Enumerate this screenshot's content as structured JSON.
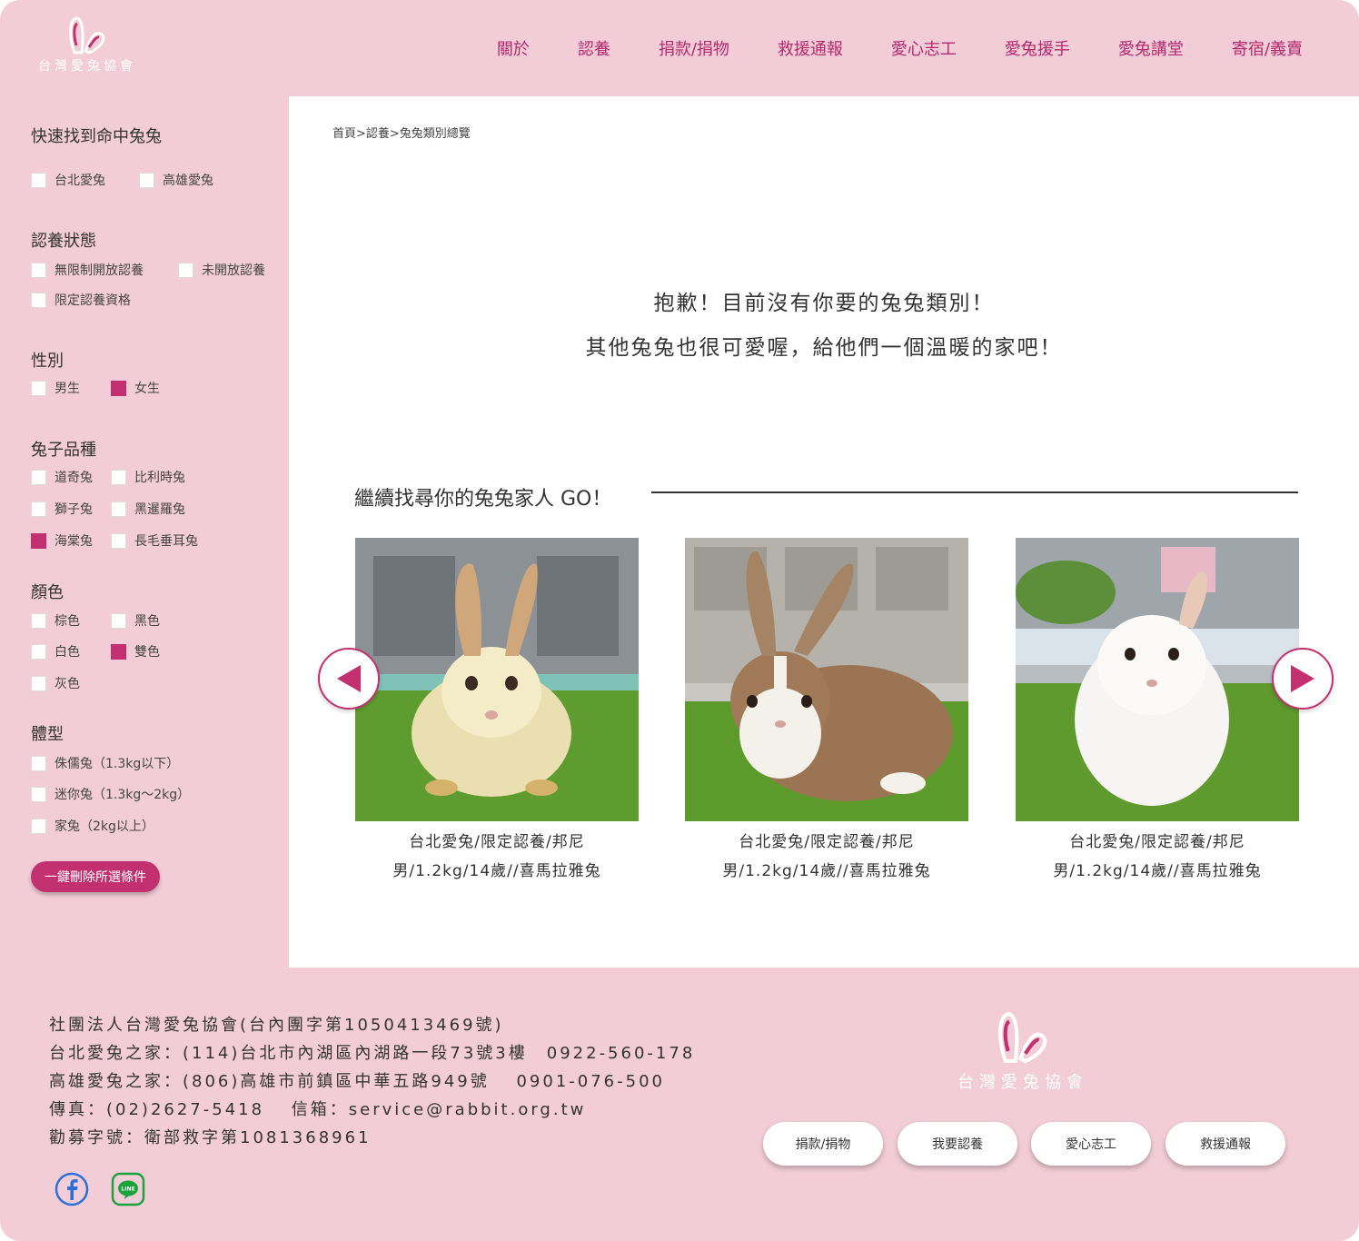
{
  "brand": {
    "logo_text": "台灣愛兔協會",
    "accent": "#c2306f",
    "bg": "#f2cdd8"
  },
  "nav": [
    "關於",
    "認養",
    "捐款/捐物",
    "救援通報",
    "愛心志工",
    "愛兔援手",
    "愛兔講堂",
    "寄宿/義賣"
  ],
  "filters": {
    "location": {
      "title": "快速找到命中兔兔",
      "options": [
        {
          "label": "台北愛兔",
          "checked": false
        },
        {
          "label": "高雄愛兔",
          "checked": false
        }
      ]
    },
    "status": {
      "title": "認養狀態",
      "options": [
        {
          "label": "無限制開放認養",
          "checked": false
        },
        {
          "label": "未開放認養",
          "checked": false
        },
        {
          "label": "限定認養資格",
          "checked": false
        }
      ]
    },
    "gender": {
      "title": "性別",
      "options": [
        {
          "label": "男生",
          "checked": false
        },
        {
          "label": "女生",
          "checked": true
        }
      ]
    },
    "breed": {
      "title": "兔子品種",
      "options": [
        {
          "label": "道奇兔",
          "checked": false
        },
        {
          "label": "比利時兔",
          "checked": false
        },
        {
          "label": "獅子兔",
          "checked": false
        },
        {
          "label": "黑暹羅兔",
          "checked": false
        },
        {
          "label": "海棠兔",
          "checked": true
        },
        {
          "label": "長毛垂耳兔",
          "checked": false
        }
      ]
    },
    "color": {
      "title": "顏色",
      "options": [
        {
          "label": "棕色",
          "checked": false
        },
        {
          "label": "黑色",
          "checked": false
        },
        {
          "label": "白色",
          "checked": false
        },
        {
          "label": "雙色",
          "checked": true
        },
        {
          "label": "灰色",
          "checked": false
        }
      ]
    },
    "size": {
      "title": "體型",
      "options": [
        {
          "label": "侏儒兔（1.3kg以下）",
          "checked": false
        },
        {
          "label": "迷你兔（1.3kg～2kg）",
          "checked": false
        },
        {
          "label": "家兔（2kg以上）",
          "checked": false
        }
      ]
    },
    "clear_label": "一鍵刪除所選條件"
  },
  "main": {
    "breadcrumb": "首頁>認養>兔兔類別總覽",
    "message_line1": "抱歉！目前沒有你要的兔兔類別！",
    "message_line2": "其他兔兔也很可愛喔，給他們一個溫暖的家吧！",
    "continue_title": "繼續找尋你的兔兔家人 GO！",
    "cards": [
      {
        "line1": "台北愛兔/限定認養/邦尼",
        "line2": "男/1.2kg/14歲//喜馬拉雅兔"
      },
      {
        "line1": "台北愛兔/限定認養/邦尼",
        "line2": "男/1.2kg/14歲//喜馬拉雅兔"
      },
      {
        "line1": "台北愛兔/限定認養/邦尼",
        "line2": "男/1.2kg/14歲//喜馬拉雅兔"
      }
    ]
  },
  "footer": {
    "lines": [
      "社團法人台灣愛兔協會(台內團字第1050413469號)",
      "台北愛兔之家：(114)台北市內湖區內湖路一段73號3樓　0922-560-178",
      "高雄愛兔之家：(806)高雄市前鎮區中華五路949號　 0901-076-500",
      "傳真：(02)2627-5418　 信箱：service@rabbit.org.tw",
      "勸募字號：衛部救字第1081368961"
    ],
    "logo_text": "台灣愛兔協會",
    "buttons": [
      "捐款/捐物",
      "我要認養",
      "愛心志工",
      "救援通報"
    ],
    "social": [
      "facebook-icon",
      "line-icon"
    ]
  }
}
